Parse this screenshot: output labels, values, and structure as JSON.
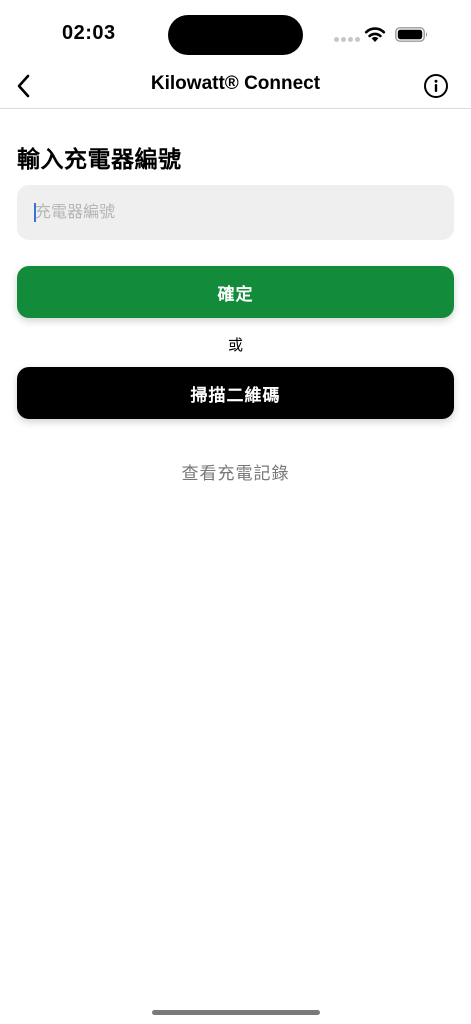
{
  "status_bar": {
    "time": "02:03",
    "icons": [
      "signal-dots-icon",
      "wifi-icon",
      "battery-icon"
    ]
  },
  "nav": {
    "title": "Kilowatt® Connect",
    "back_icon": "chevron-left-icon",
    "info_icon": "info-circle-icon"
  },
  "main": {
    "heading": "輸入充電器編號",
    "charger_input": {
      "value": "",
      "placeholder": "充電器編號"
    },
    "confirm_label": "確定",
    "or_label": "或",
    "scan_label": "掃描二維碼",
    "history_link": "查看充電記錄"
  },
  "colors": {
    "primary_green": "#128c3a",
    "scan_button": "#000000",
    "input_background": "#efefef",
    "link_gray": "#777777",
    "caret": "#3a6fe0"
  }
}
